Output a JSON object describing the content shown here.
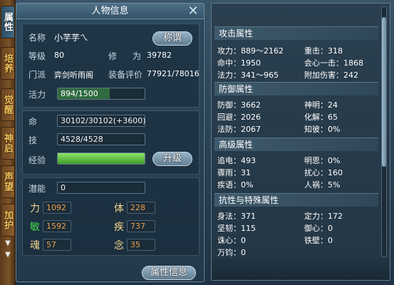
{
  "side_tabs": [
    {
      "label": "属性",
      "active": true
    },
    {
      "label": "培养",
      "active": false
    },
    {
      "label": "觉醒",
      "active": false
    },
    {
      "label": "神启",
      "active": false
    },
    {
      "label": "声望",
      "active": false
    },
    {
      "label": "加护",
      "active": false
    }
  ],
  "panel": {
    "title": "人物信息",
    "close_icon": "✕",
    "name_label": "名称",
    "name_value": "小芋芋ㄟ",
    "title_button": "称谓",
    "level_label": "等级",
    "level_value": "80",
    "cultivation_label": "修",
    "cultivation_label2": "为",
    "cultivation_value": "39782",
    "sect_label": "门派",
    "sect_value": "弈剑听雨阁",
    "equip_label": "装备评价",
    "equip_value": "77921/78016",
    "vitality_label": "活力",
    "vitality_value": "894/1500",
    "vitality_fraction": 0.596,
    "hp_label": "命",
    "hp_value": "30102/30102(+3600)",
    "skill_label": "技",
    "skill_value": "4528/4528",
    "exp_label": "经验",
    "exp_fraction": 1.0,
    "upgrade_button": "升级",
    "potential_label": "潜能",
    "potential_value": "0",
    "attributes": [
      {
        "name": "力",
        "value": "1092",
        "green": false
      },
      {
        "name": "体",
        "value": "228",
        "green": false
      },
      {
        "name": "敏",
        "value": "1592",
        "green": true
      },
      {
        "name": "疾",
        "value": "737",
        "green": false
      },
      {
        "name": "魂",
        "value": "57",
        "green": false
      },
      {
        "name": "念",
        "value": "35",
        "green": false
      }
    ],
    "attr_info_button": "属性信息"
  },
  "stats": {
    "attack_head": "攻击属性",
    "attack": [
      {
        "left": "攻力：889～2162",
        "right": "重击：318"
      },
      {
        "left": "命中：1950",
        "right": "会心一击：1868"
      },
      {
        "left": "法力：341～965",
        "right": "附加伤害：242"
      }
    ],
    "defense_head": "防御属性",
    "defense": [
      {
        "left": "防御：3662",
        "right": "神明：24"
      },
      {
        "left": "回避：2026",
        "right": "化解：65"
      },
      {
        "left": "法防：2067",
        "right": "知彼：0%"
      }
    ],
    "advanced_head": "高级属性",
    "advanced": [
      {
        "left": "追电：493",
        "right": "明思：0%"
      },
      {
        "left": "骤雨：31",
        "right": "扰心：160"
      },
      {
        "left": "疾语：0%",
        "right": "人祸：5%"
      }
    ],
    "resist_head": "抗性与特殊属性",
    "resist": [
      {
        "left": "身法：371",
        "right": "定力：172"
      },
      {
        "left": "坚韧：115",
        "right": "御心：0"
      },
      {
        "left": "诛心：0",
        "right": "铁壁：0"
      },
      {
        "left": "万钧：0",
        "right": ""
      }
    ]
  },
  "colors": {
    "accent_gold": "#f2d38a",
    "attr_value": "#e8a04a",
    "exp_green": "#57c93a",
    "vitality_green": "#2f6b3e"
  }
}
